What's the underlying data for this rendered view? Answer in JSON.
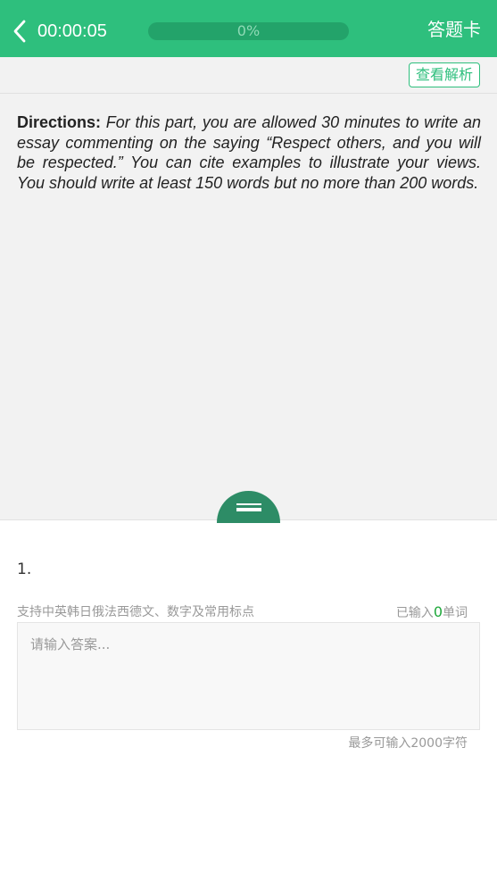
{
  "header": {
    "timer": "00:00:05",
    "progress_text": "0%",
    "progress": 0,
    "answer_card_label": "答题卡",
    "back_icon": "chevron-left-icon"
  },
  "subbar": {
    "analysis_label": "查看解析"
  },
  "passage": {
    "directions_label": "Directions:",
    "directions_text": " For this part, you are allowed 30 minutes to write an essay commenting on the saying “Respect others, and you will be respected.” You can cite examples to illustrate your views. You should write at least 150 words but no more than 200 words."
  },
  "answer": {
    "question_number": "1.",
    "hint": "支持中英韩日俄法西德文、数字及常用标点",
    "count_prefix": "已输入",
    "count_value": "0",
    "count_suffix": "单词",
    "placeholder": "请输入答案...",
    "value": "",
    "limit": "最多可输入2000字符"
  },
  "colors": {
    "brand": "#2ebf7d",
    "handle": "#2d8c66",
    "count_highlight": "#1ea83a"
  }
}
